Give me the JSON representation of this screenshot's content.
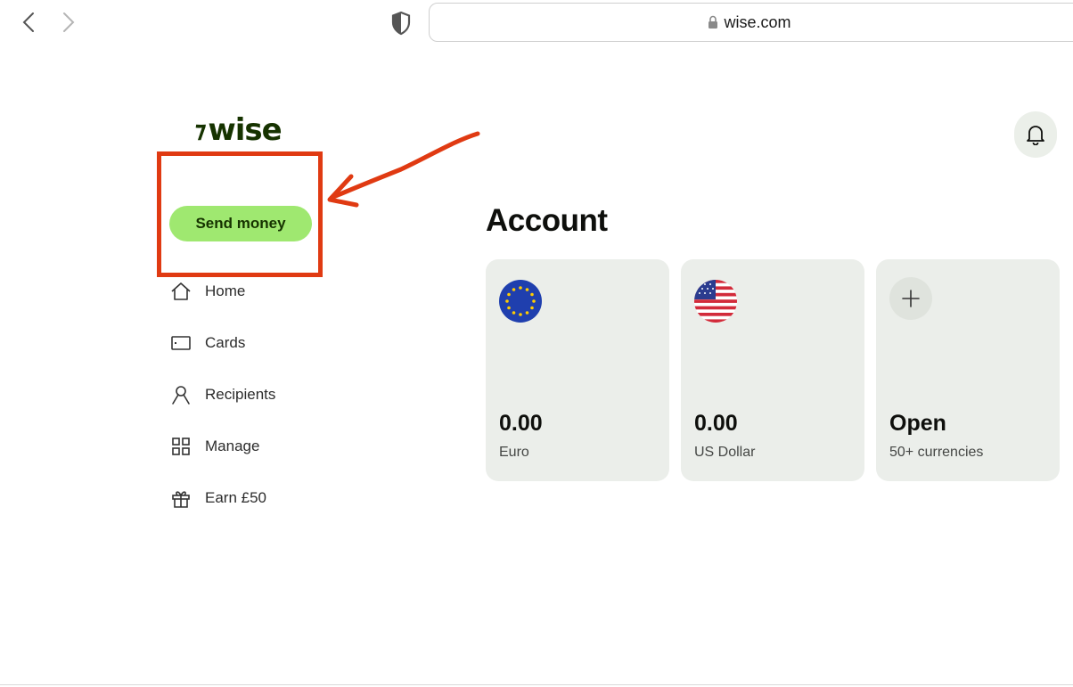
{
  "browser": {
    "url": "wise.com",
    "icons": [
      "chevron-left-icon",
      "chevron-right-icon",
      "shield-icon",
      "lock-icon"
    ]
  },
  "brand": {
    "logo_text": "wise",
    "primary_color": "#9fe870",
    "dark_green": "#163300"
  },
  "sidebar": {
    "send_money_label": "Send money",
    "items": [
      {
        "label": "Home",
        "icon": "home-icon"
      },
      {
        "label": "Cards",
        "icon": "card-icon"
      },
      {
        "label": "Recipients",
        "icon": "recipients-icon"
      },
      {
        "label": "Manage",
        "icon": "grid-icon"
      },
      {
        "label": "Earn £50",
        "icon": "gift-icon"
      }
    ]
  },
  "header": {
    "bell_icon": "bell-icon"
  },
  "main": {
    "title": "Account",
    "cards": [
      {
        "amount": "0.00",
        "currency": "Euro",
        "flag": "eu-flag-icon"
      },
      {
        "amount": "0.00",
        "currency": "US Dollar",
        "flag": "us-flag-icon"
      },
      {
        "amount": "Open",
        "currency": "50+ currencies",
        "icon": "plus-icon"
      }
    ]
  },
  "annotation": {
    "color": "#e03a12",
    "target": "send-money-button"
  }
}
